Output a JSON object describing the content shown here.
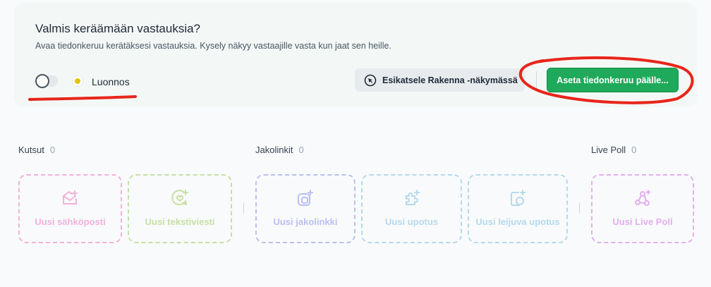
{
  "banner": {
    "title": "Valmis keräämään vastauksia?",
    "subtitle": "Avaa tiedonkeruu kerätäksesi vastauksia. Kysely näkyy vastaajille vasta kun jaat sen heille.",
    "status_label": "Luonnos",
    "preview_label": "Esikatsele Rakenna -näkymässä",
    "enable_label": "Aseta tiedonkeruu päälle...",
    "toggle_on": false
  },
  "groups": [
    {
      "title": "Kutsut",
      "count": "0"
    },
    {
      "title": "Jakolinkit",
      "count": "0"
    },
    {
      "title": "Live Poll",
      "count": "0"
    }
  ],
  "cards": [
    {
      "label": "Uusi sähköposti",
      "icon": "email-plus-icon",
      "color": "#f2b1da"
    },
    {
      "label": "Uusi tekstiviesti",
      "icon": "message-heart-icon",
      "color": "#c7dfa4"
    },
    {
      "label": "Uusi jakolinkki",
      "icon": "link-plus-icon",
      "color": "#bcbff0"
    },
    {
      "label": "Uusi upotus",
      "icon": "puzzle-plus-icon",
      "color": "#b5d9ee"
    },
    {
      "label": "Uusi leijuva upotus",
      "icon": "floating-embed-icon",
      "color": "#b5d9ee"
    },
    {
      "label": "Uusi Live Poll",
      "icon": "live-poll-icon",
      "color": "#e3aef0"
    }
  ],
  "colors": {
    "accent_green": "#1eaa5a",
    "annotation_red": "#e8251a",
    "status_yellow": "#e6c400"
  }
}
